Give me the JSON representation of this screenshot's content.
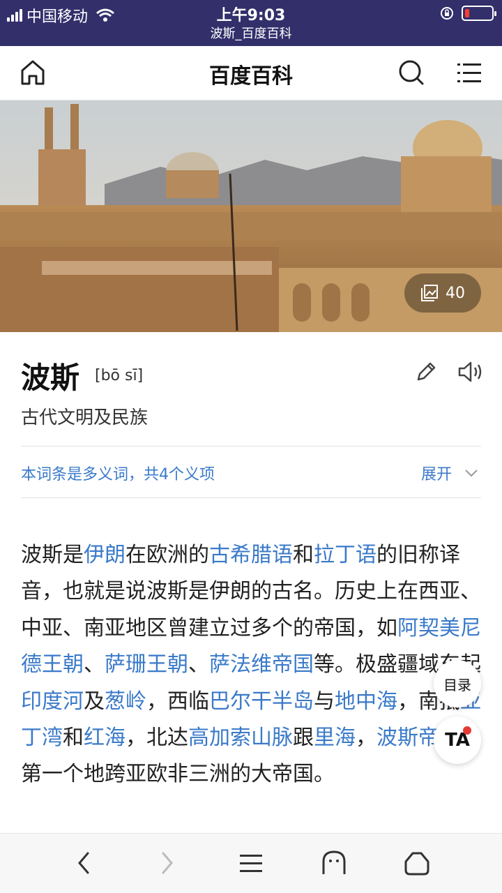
{
  "status_bar": {
    "carrier": "中国移动",
    "time": "上午9:03",
    "page_url": "波斯_百度百科"
  },
  "header": {
    "title": "百度百科"
  },
  "hero": {
    "photo_count": "40"
  },
  "entry": {
    "title": "波斯",
    "pinyin": "[bō sī]",
    "subtitle": "古代文明及民族"
  },
  "polysemy": {
    "text": "本词条是多义词，共4个义项",
    "expand_label": "展开"
  },
  "paragraph": [
    {
      "t": "波斯是",
      "link": false
    },
    {
      "t": "伊朗",
      "link": true
    },
    {
      "t": "在欧洲的",
      "link": false
    },
    {
      "t": "古希腊语",
      "link": true
    },
    {
      "t": "和",
      "link": false
    },
    {
      "t": "拉丁语",
      "link": true
    },
    {
      "t": "的旧称译音，也就是说波斯是伊朗的古名。历史上在西亚、中亚、南亚地区曾建立过多个的帝国，如",
      "link": false
    },
    {
      "t": "阿契美尼德王朝",
      "link": true
    },
    {
      "t": "、",
      "link": false
    },
    {
      "t": "萨珊王朝",
      "link": true
    },
    {
      "t": "、",
      "link": false
    },
    {
      "t": "萨法维帝国",
      "link": true
    },
    {
      "t": "等。极盛疆域东起",
      "link": false
    },
    {
      "t": "印度河",
      "link": true
    },
    {
      "t": "及",
      "link": false
    },
    {
      "t": "葱岭",
      "link": true
    },
    {
      "t": "，西临",
      "link": false
    },
    {
      "t": "巴尔干半岛",
      "link": true
    },
    {
      "t": "与",
      "link": false
    },
    {
      "t": "地中海",
      "link": true
    },
    {
      "t": "，南抵",
      "link": false
    },
    {
      "t": "亚丁湾",
      "link": true
    },
    {
      "t": "和",
      "link": false
    },
    {
      "t": "红海",
      "link": true
    },
    {
      "t": "，北达",
      "link": false
    },
    {
      "t": "高加索山脉",
      "link": true
    },
    {
      "t": "跟",
      "link": false
    },
    {
      "t": "里海",
      "link": true
    },
    {
      "t": "，",
      "link": false
    },
    {
      "t": "波斯帝国",
      "link": true
    },
    {
      "t": "是第一个地跨亚欧非三洲的大帝国。",
      "link": false
    }
  ],
  "floating": {
    "toc_label": "目录",
    "ta_label": "TA"
  },
  "colors": {
    "status_bar_bg": "#332f6b",
    "link": "#3a7ac9"
  }
}
